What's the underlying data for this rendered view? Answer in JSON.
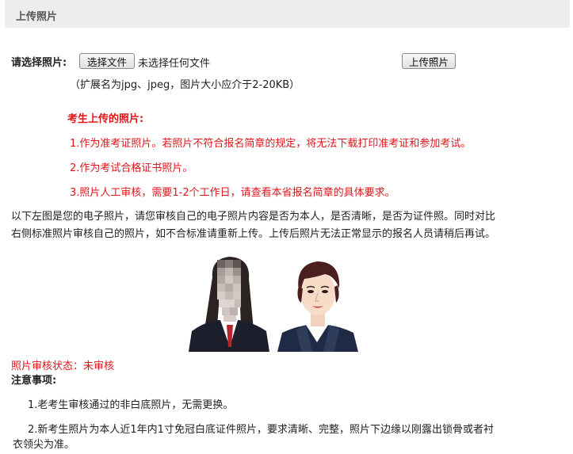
{
  "header": {
    "title": "上传照片"
  },
  "upload": {
    "label": "请选择照片:",
    "choose_button": "选择文件",
    "no_file_text": "未选择任何文件",
    "upload_button": "上传照片",
    "hint": "（扩展名为jpg、jpeg，图片大小应介于2-20KB）"
  },
  "notes_red": {
    "title": "考生上传的照片:",
    "items": [
      "1.作为准考证照片。若照片不符合报名简章的规定，将无法下载打印准考证和参加考试。",
      "2.作为考试合格证书照片。",
      "3.照片人工审核，需要1-2个工作日，请查看本省报名简章的具体要求。"
    ]
  },
  "description": [
    "以下左图是您的电子照片，请您审核自己的电子照片内容是否为本人，是否清晰，是否为证件照。同时对比",
    "右侧标准照片审核自己的照片，如不合标准请重新上传。上传后照片无法正常显示的报名人员请稍后再试。"
  ],
  "review": {
    "status_text": "照片审核状态：未审核"
  },
  "attention": {
    "title": "注意事项:",
    "items": [
      "1.老考生审核通过的非白底照片，无需更换。",
      "2.新考生照片为本人近1年内1寸免冠白底证件照片，要求清晰、完整，照片下边缘以刚露出锁骨或者衬",
      "衣领尖为准。"
    ]
  }
}
